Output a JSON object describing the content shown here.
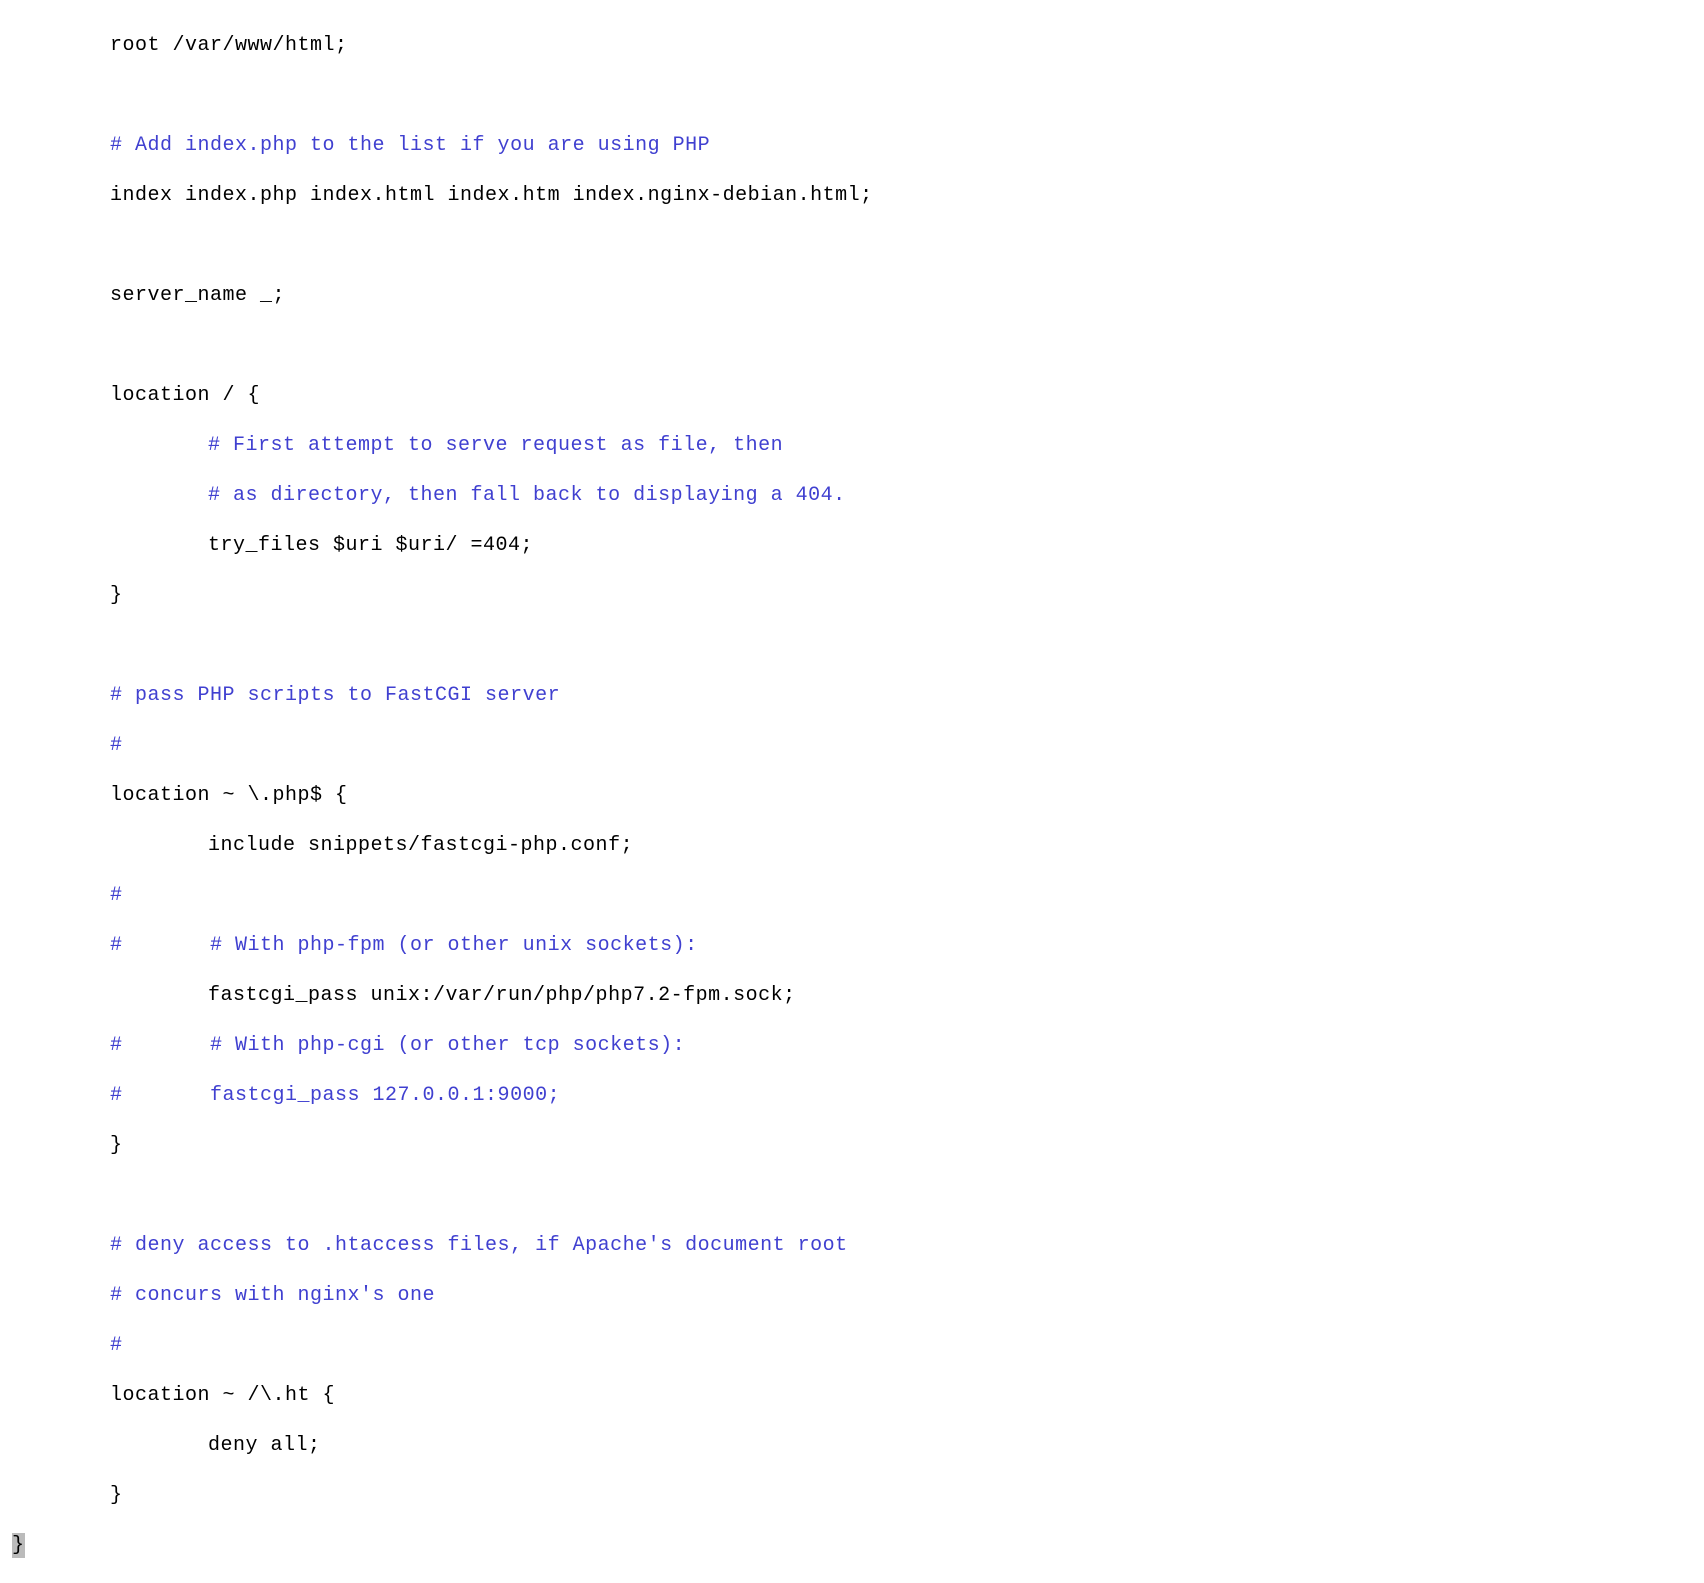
{
  "lines": {
    "root": "root /var/www/html;",
    "blank": "",
    "comment_php_index": "# Add index.php to the list if you are using PHP",
    "index_directive": "index index.php index.html index.htm index.nginx-debian.html;",
    "server_name": "server_name _;",
    "location_root": "location / {",
    "comment_first_attempt": "# First attempt to serve request as file, then",
    "comment_as_directory": "# as directory, then fall back to displaying a 404.",
    "try_files": "try_files $uri $uri/ =404;",
    "close_brace": "}",
    "comment_pass_php": "# pass PHP scripts to FastCGI server",
    "hash_only": "#",
    "location_php": "location ~ \\.php$ {",
    "include_snippets": "include snippets/fastcgi-php.conf;",
    "comment_with_fpm_prefix": "#       ",
    "comment_with_fpm": "# With php-fpm (or other unix sockets):",
    "fastcgi_pass_unix": "fastcgi_pass unix:/var/run/php/php7.2-fpm.sock;",
    "comment_with_cgi": "# With php-cgi (or other tcp sockets):",
    "comment_fastcgi_tcp_prefix": "#       ",
    "fastcgi_pass_tcp": "fastcgi_pass 127.0.0.1:9000;",
    "comment_deny_htaccess": "# deny access to .htaccess files, if Apache's document root",
    "comment_concurs": "# concurs with nginx's one",
    "location_ht": "location ~ /\\.ht {",
    "deny_all": "deny all;",
    "final_brace": "}"
  }
}
